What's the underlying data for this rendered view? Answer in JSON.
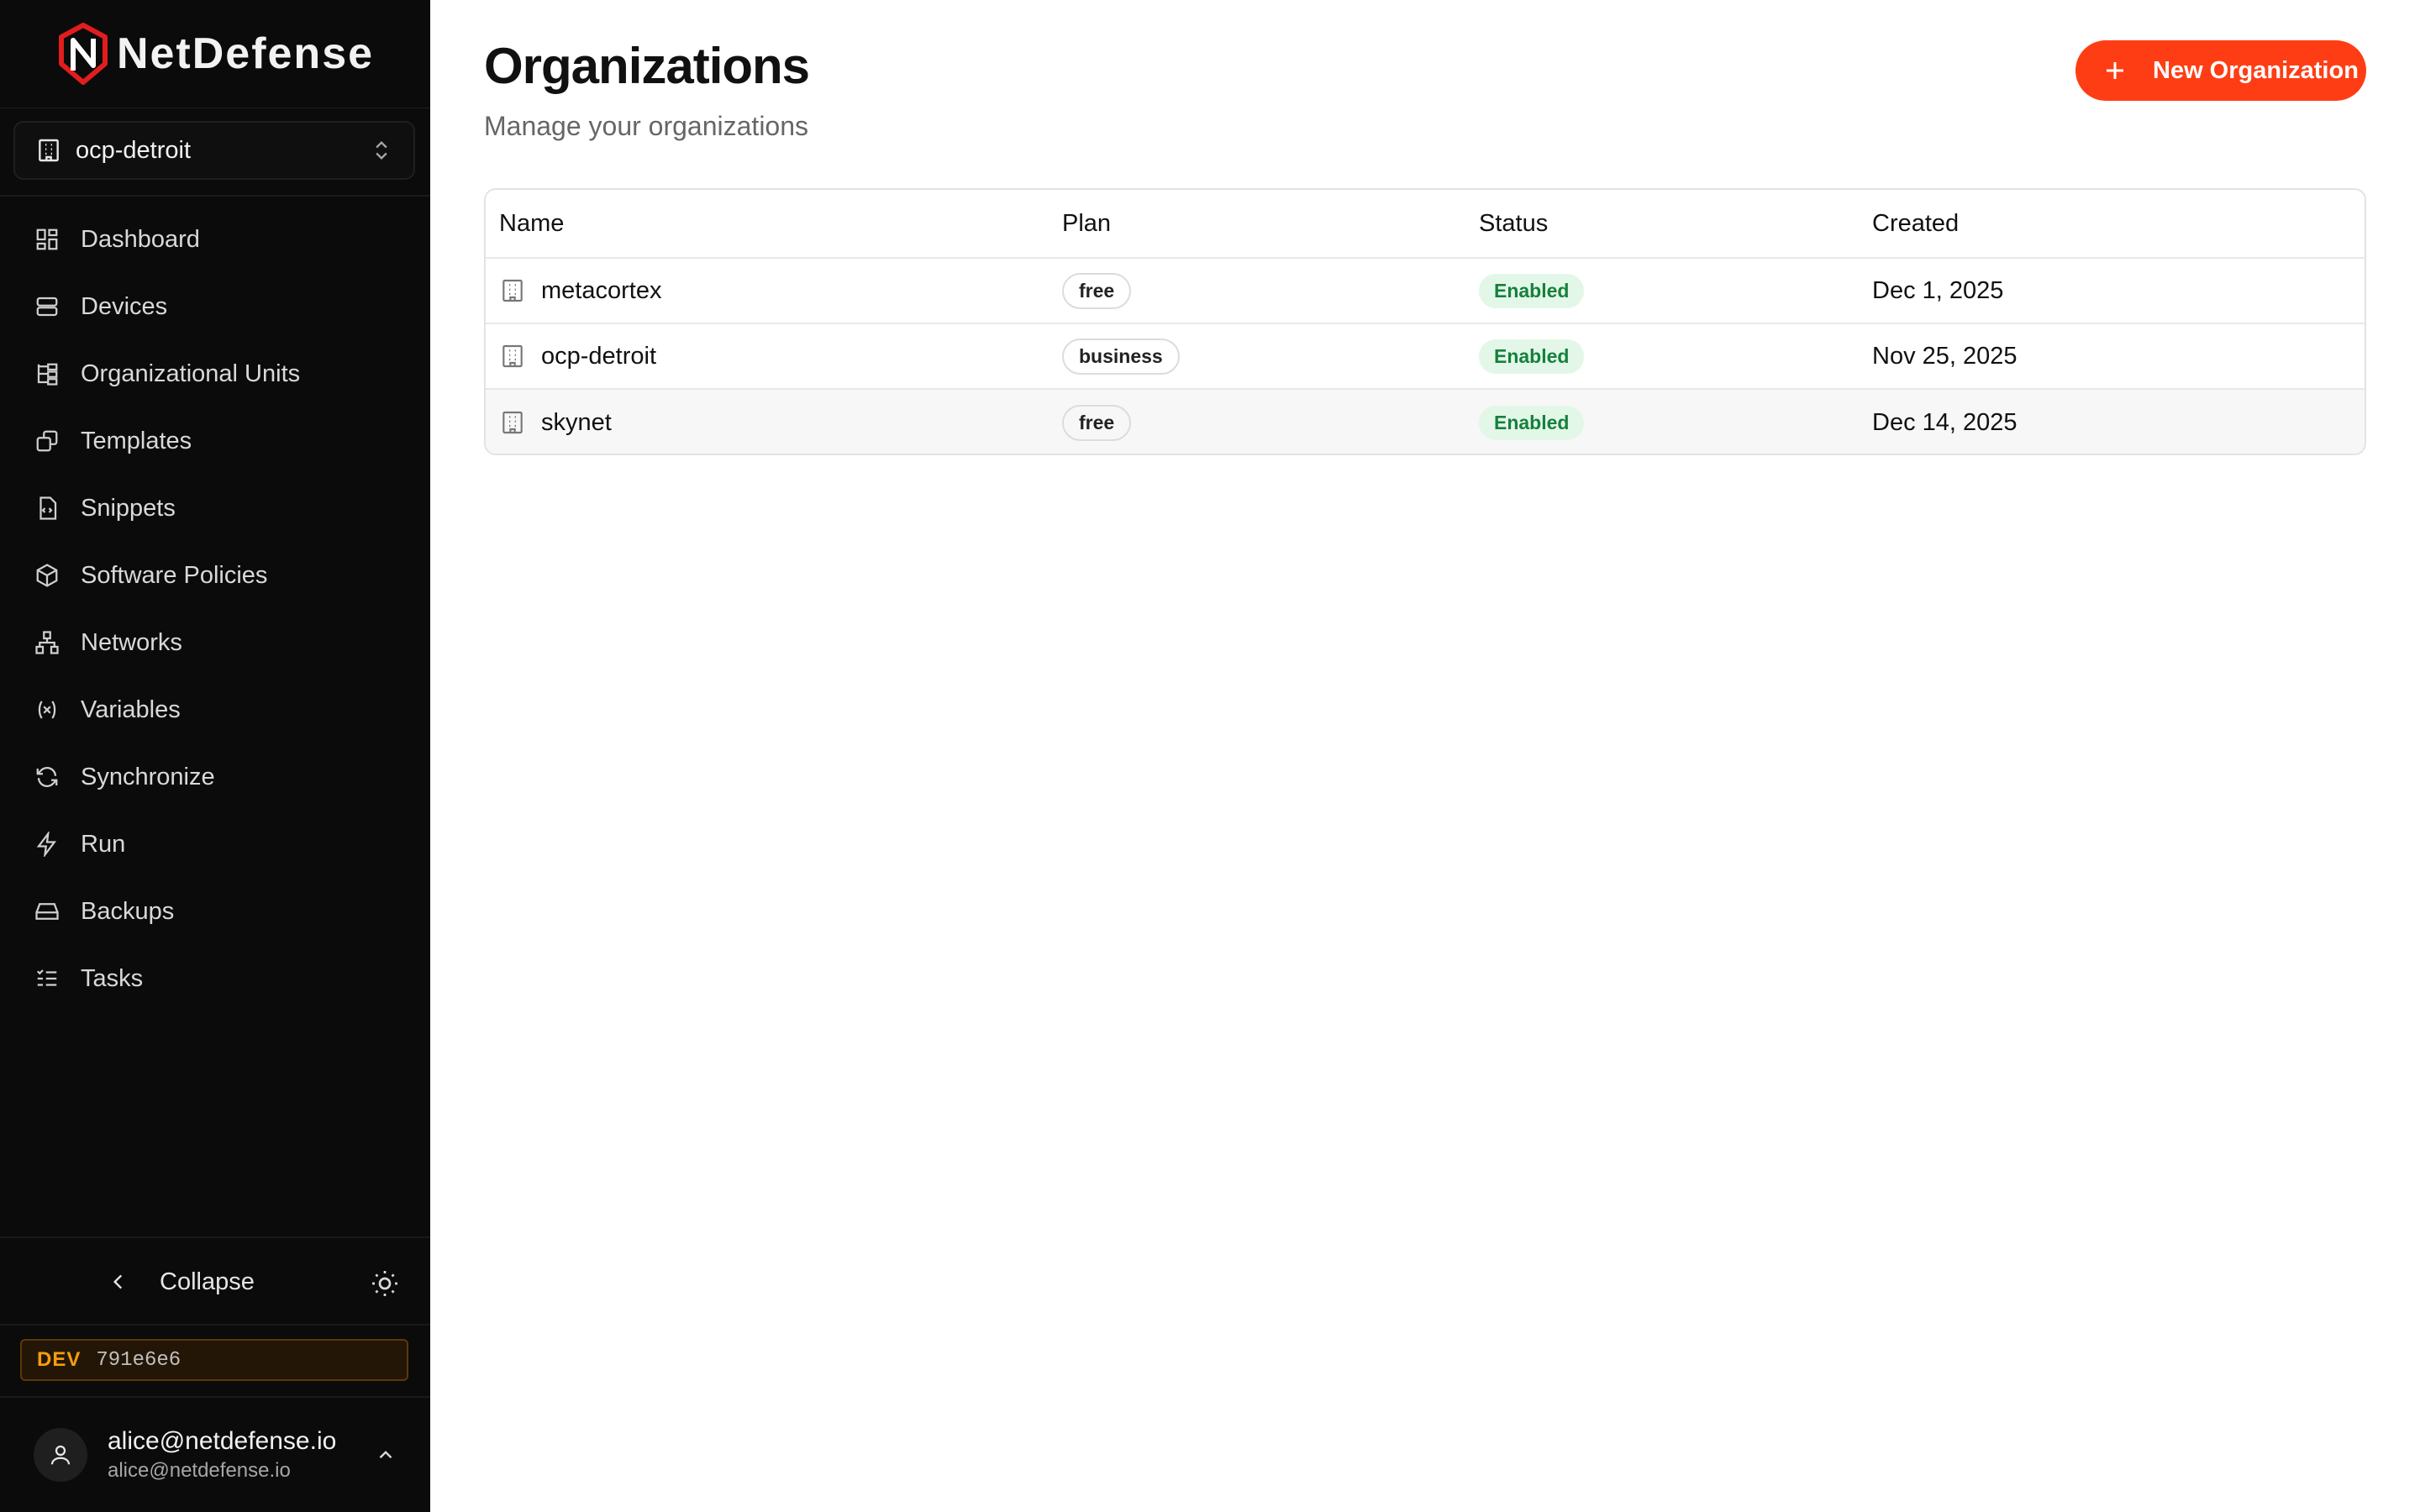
{
  "brand": {
    "name": "NetDefense",
    "accent": "#ff3d14"
  },
  "org_switcher": {
    "current": "ocp-detroit"
  },
  "nav": [
    {
      "label": "Dashboard",
      "icon": "dashboard-icon"
    },
    {
      "label": "Devices",
      "icon": "server-icon"
    },
    {
      "label": "Organizational Units",
      "icon": "tree-icon"
    },
    {
      "label": "Templates",
      "icon": "template-icon"
    },
    {
      "label": "Snippets",
      "icon": "file-code-icon"
    },
    {
      "label": "Software Policies",
      "icon": "package-icon"
    },
    {
      "label": "Networks",
      "icon": "network-icon"
    },
    {
      "label": "Variables",
      "icon": "variable-icon"
    },
    {
      "label": "Synchronize",
      "icon": "refresh-icon"
    },
    {
      "label": "Run",
      "icon": "zap-icon"
    },
    {
      "label": "Backups",
      "icon": "hard-drive-icon"
    },
    {
      "label": "Tasks",
      "icon": "list-checks-icon"
    }
  ],
  "sidebar_footer": {
    "collapse_label": "Collapse",
    "env_label": "DEV",
    "build_hash": "791e6e6",
    "user_name": "alice@netdefense.io",
    "user_email": "alice@netdefense.io"
  },
  "header": {
    "title": "Organizations",
    "subtitle": "Manage your organizations",
    "new_button": "New Organization"
  },
  "table": {
    "columns": [
      "Name",
      "Plan",
      "Status",
      "Created"
    ],
    "rows": [
      {
        "name": "metacortex",
        "plan": "free",
        "status": "Enabled",
        "created": "Dec 1, 2025"
      },
      {
        "name": "ocp-detroit",
        "plan": "business",
        "status": "Enabled",
        "created": "Nov 25, 2025"
      },
      {
        "name": "skynet",
        "plan": "free",
        "status": "Enabled",
        "created": "Dec 14, 2025"
      }
    ]
  }
}
